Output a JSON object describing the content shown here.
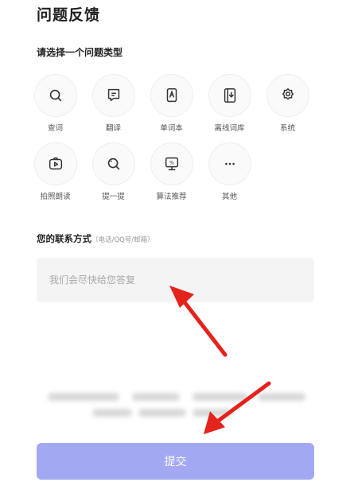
{
  "header": {
    "title": "问题反馈"
  },
  "type_section": {
    "title": "请选择一个问题类型",
    "items": [
      {
        "label": "查词",
        "icon": "search-icon"
      },
      {
        "label": "翻译",
        "icon": "translate-icon"
      },
      {
        "label": "单词本",
        "icon": "wordbook-icon"
      },
      {
        "label": "离线词库",
        "icon": "offline-dictionary-icon"
      },
      {
        "label": "系统",
        "icon": "settings-gear-icon"
      },
      {
        "label": "拍照朗读",
        "icon": "camera-read-icon"
      },
      {
        "label": "提一提",
        "icon": "scan-icon"
      },
      {
        "label": "算法推荐",
        "icon": "algorithm-icon"
      },
      {
        "label": "其他",
        "icon": "more-icon"
      }
    ]
  },
  "contact": {
    "label": "您的联系方式",
    "hint": "（电话/QQ号/邮箱）",
    "placeholder": "我们会尽快给您答复",
    "value": ""
  },
  "submit": {
    "label": "提交"
  },
  "colors": {
    "submit_button": "#a2a8f2",
    "input_background": "#f4f4f4",
    "annotation_arrow": "#e3231c"
  }
}
